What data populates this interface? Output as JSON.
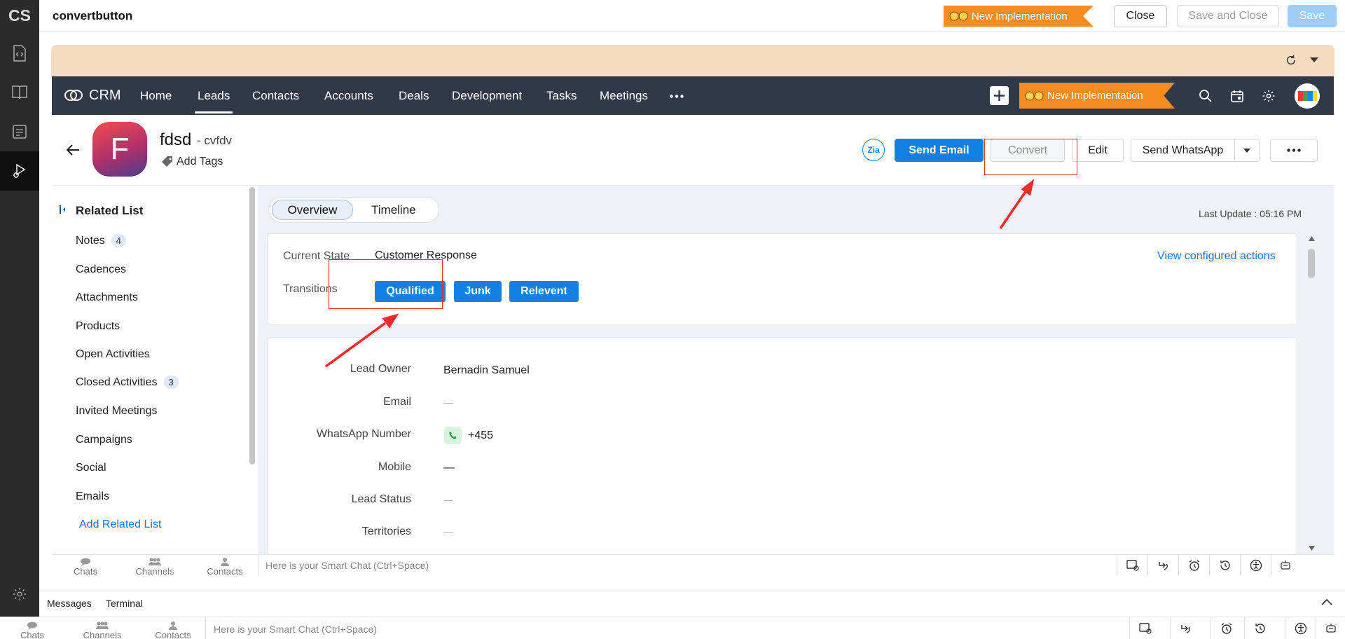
{
  "rail": {
    "logo": "CS"
  },
  "topbar": {
    "title": "convertbutton",
    "implementation_tag": "New Implementation",
    "close_label": "Close",
    "save_close_label": "Save and Close",
    "save_label": "Save"
  },
  "crm": {
    "brand": "CRM",
    "nav": [
      "Home",
      "Leads",
      "Contacts",
      "Accounts",
      "Deals",
      "Development",
      "Tasks",
      "Meetings"
    ],
    "active_nav": "Leads",
    "implementation_tag": "New Implementation"
  },
  "record": {
    "avatar_letter": "F",
    "name": "fdsd",
    "company": "- cvfdv",
    "add_tags": "Add Tags",
    "zia_label": "Zia",
    "buttons": {
      "send_email": "Send Email",
      "convert": "Convert",
      "edit": "Edit",
      "send_whatsapp": "Send WhatsApp"
    }
  },
  "related": {
    "title": "Related List",
    "items": [
      {
        "label": "Notes",
        "count": "4"
      },
      {
        "label": "Cadences"
      },
      {
        "label": "Attachments"
      },
      {
        "label": "Products"
      },
      {
        "label": "Open Activities"
      },
      {
        "label": "Closed Activities",
        "count": "3"
      },
      {
        "label": "Invited Meetings"
      },
      {
        "label": "Campaigns"
      },
      {
        "label": "Social"
      },
      {
        "label": "Emails"
      }
    ],
    "add_link": "Add Related List"
  },
  "tabs": {
    "overview": "Overview",
    "timeline": "Timeline"
  },
  "last_update": "Last Update : 05:16 PM",
  "blueprint": {
    "current_state_label": "Current State",
    "current_state": "Customer Response",
    "transitions_label": "Transitions",
    "transitions": [
      "Qualified",
      "Junk",
      "Relevent"
    ],
    "view_actions": "View configured actions"
  },
  "fields": [
    {
      "label": "Lead Owner",
      "value": "Bernadin Samuel"
    },
    {
      "label": "Email",
      "value": "—"
    },
    {
      "label": "WhatsApp Number",
      "value": "+455"
    },
    {
      "label": "Mobile",
      "value": "—"
    },
    {
      "label": "Lead Status",
      "value": "—"
    },
    {
      "label": "Territories",
      "value": "—"
    }
  ],
  "chat": {
    "tabs": [
      "Chats",
      "Channels",
      "Contacts"
    ],
    "placeholder": "Here is your Smart Chat (Ctrl+Space)"
  },
  "console": {
    "messages": "Messages",
    "terminal": "Terminal"
  },
  "colors": {
    "primary": "#1280e6",
    "nav_bg": "#313949",
    "impl_tag": "#f58c1f",
    "annotation": "#ee2b2b",
    "rail": "#2b2b2b"
  }
}
